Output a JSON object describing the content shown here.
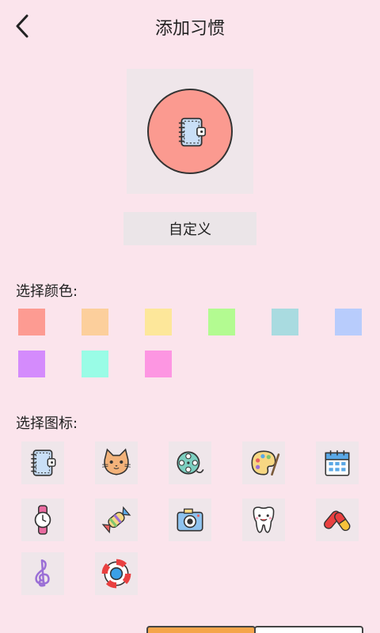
{
  "header": {
    "title": "添加习惯"
  },
  "preview": {
    "color": "#fb9a90",
    "icon": "notebook-icon"
  },
  "custom_button": {
    "label": "自定义"
  },
  "color_section": {
    "label": "选择颜色:",
    "colors": [
      "#fd9b92",
      "#fccf9c",
      "#fde79a",
      "#b3fb91",
      "#a9dbe0",
      "#b8ccfc",
      "#d48bfc",
      "#99fce6",
      "#fd96e2"
    ]
  },
  "icon_section": {
    "label": "选择图标:",
    "icons": [
      "notebook-icon",
      "cat-icon",
      "film-reel-icon",
      "palette-icon",
      "calendar-icon",
      "wristwatch-icon",
      "candy-icon",
      "camera-icon",
      "tooth-icon",
      "pills-icon",
      "treble-clef-icon",
      "lifebuoy-icon"
    ]
  }
}
